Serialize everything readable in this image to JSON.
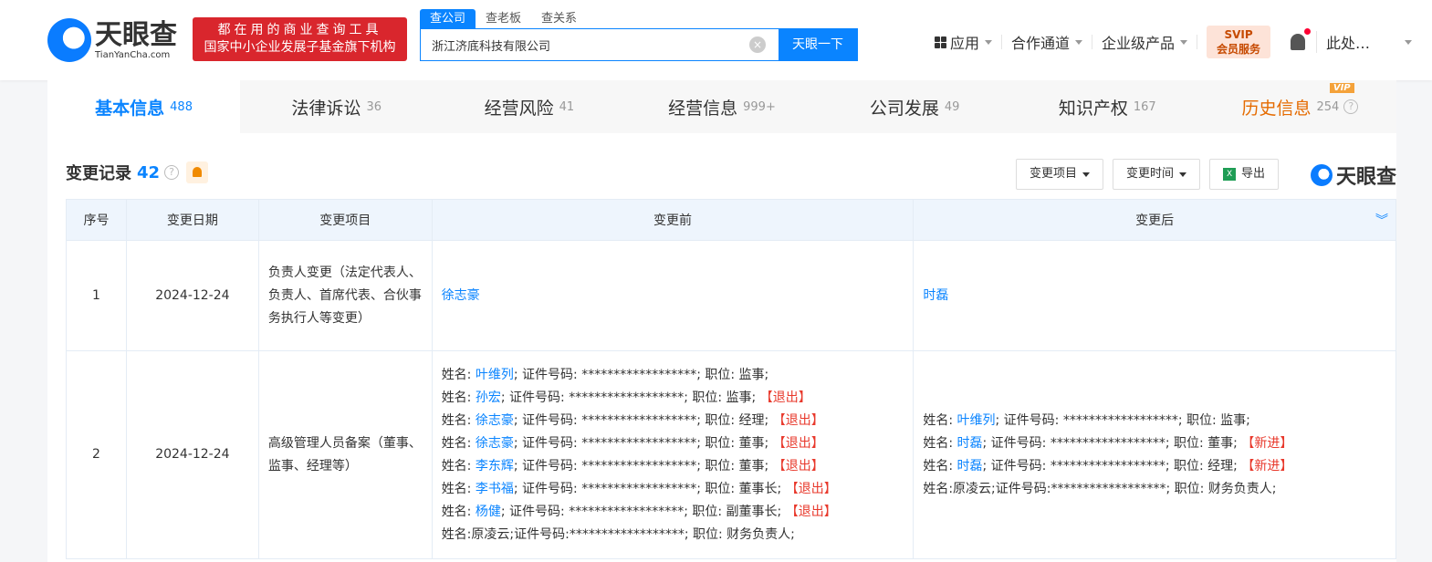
{
  "header": {
    "logo_cn": "天眼查",
    "logo_en": "TianYanCha.com",
    "slogan_line1": "都在用的商业查询工具",
    "slogan_line2": "国家中小企业发展子基金旗下机构",
    "search_tabs": [
      "查公司",
      "查老板",
      "查关系"
    ],
    "search_value": "浙江济底科技有限公司",
    "search_button": "天眼一下",
    "nav": [
      "应用",
      "合作通道",
      "企业级产品"
    ],
    "svip_top": "SVIP",
    "svip_bottom": "会员服务",
    "user": "此处…"
  },
  "tabs": [
    {
      "label": "基本信息",
      "count": "488"
    },
    {
      "label": "法律诉讼",
      "count": "36"
    },
    {
      "label": "经营风险",
      "count": "41"
    },
    {
      "label": "经营信息",
      "count": "999+"
    },
    {
      "label": "公司发展",
      "count": "49"
    },
    {
      "label": "知识产权",
      "count": "167"
    },
    {
      "label": "历史信息",
      "count": "254",
      "badge": "VIP"
    }
  ],
  "section": {
    "title": "变更记录",
    "count": "42",
    "filter_item": "变更项目",
    "filter_time": "变更时间",
    "export": "导出",
    "brand": "天眼查"
  },
  "table": {
    "headers": [
      "序号",
      "变更日期",
      "变更项目",
      "变更前",
      "变更后"
    ],
    "rows": [
      {
        "no": "1",
        "date": "2024-12-24",
        "item": "负责人变更（法定代表人、负责人、首席代表、合伙事务执行人等变更）",
        "before": [
          {
            "pre": "",
            "name": "徐志豪",
            "rest": "",
            "tag": ""
          }
        ],
        "after": [
          {
            "pre": "",
            "name": "时磊",
            "rest": "",
            "tag": ""
          }
        ]
      },
      {
        "no": "2",
        "date": "2024-12-24",
        "item": "高级管理人员备案（董事、监事、经理等）",
        "before": [
          {
            "pre": "姓名: ",
            "name": "叶维列",
            "rest": "; 证件号码: ******************; 职位: 监事;",
            "tag": ""
          },
          {
            "pre": "姓名: ",
            "name": "孙宏",
            "rest": "; 证件号码: ******************; 职位: 监事; ",
            "tag": "【退出】"
          },
          {
            "pre": "姓名: ",
            "name": "徐志豪",
            "rest": "; 证件号码: ******************; 职位: 经理; ",
            "tag": "【退出】"
          },
          {
            "pre": "姓名: ",
            "name": "徐志豪",
            "rest": "; 证件号码: ******************; 职位: 董事; ",
            "tag": "【退出】"
          },
          {
            "pre": "姓名: ",
            "name": "李东辉",
            "rest": "; 证件号码: ******************; 职位: 董事; ",
            "tag": "【退出】"
          },
          {
            "pre": "姓名: ",
            "name": "李书福",
            "rest": "; 证件号码: ******************; 职位: 董事长; ",
            "tag": "【退出】"
          },
          {
            "pre": "姓名: ",
            "name": "杨健",
            "rest": "; 证件号码: ******************; 职位: 副董事长; ",
            "tag": "【退出】"
          },
          {
            "pre": "姓名:原凌云;证件号码:******************; 职位: 财务负责人;",
            "name": "",
            "rest": "",
            "tag": ""
          }
        ],
        "after": [
          {
            "pre": "姓名: ",
            "name": "叶维列",
            "rest": "; 证件号码: ******************; 职位: 监事;",
            "tag": ""
          },
          {
            "pre": "姓名: ",
            "name": "时磊",
            "rest": "; 证件号码: ******************; 职位: 董事; ",
            "tag": "【新进】"
          },
          {
            "pre": "姓名: ",
            "name": "时磊",
            "rest": "; 证件号码: ******************; 职位: 经理; ",
            "tag": "【新进】"
          },
          {
            "pre": "姓名:原凌云;证件号码:******************; 职位: 财务负责人;",
            "name": "",
            "rest": "",
            "tag": ""
          }
        ]
      }
    ]
  }
}
